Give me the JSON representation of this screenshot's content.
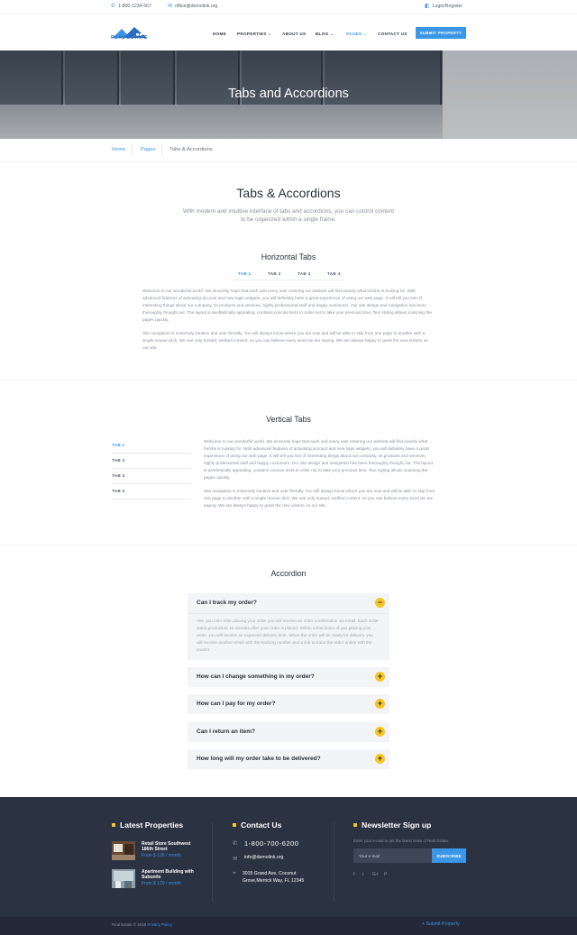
{
  "topbar": {
    "phone": "1-800-1234-567",
    "email": "office@demolink.org",
    "login": "Login/Register"
  },
  "header": {
    "logo_text": "REAL ESTATE",
    "nav": [
      {
        "label": "HOME",
        "has_dropdown": false,
        "active": false
      },
      {
        "label": "PROPERTIES",
        "has_dropdown": true,
        "active": false
      },
      {
        "label": "ABOUT US",
        "has_dropdown": false,
        "active": false
      },
      {
        "label": "BLOG",
        "has_dropdown": true,
        "active": false
      },
      {
        "label": "PAGES",
        "has_dropdown": true,
        "active": true
      },
      {
        "label": "CONTACT US",
        "has_dropdown": false,
        "active": false
      }
    ],
    "submit_label": "SUBMIT PROPERTY"
  },
  "hero": {
    "title": "Tabs and Accordions"
  },
  "breadcrumb": {
    "home": "Home",
    "pages": "Pages",
    "current": "Tabs & Accordions"
  },
  "intro": {
    "title": "Tabs & Accordions",
    "lead": "With modern and intuitive interface of tabs and accordions, you can control content to be organized within a single frame."
  },
  "horizontal": {
    "title": "Horizontal Tabs",
    "tabs": [
      "TAB 1",
      "TAB 2",
      "TAB 3",
      "TAB 4"
    ],
    "p1": "Welcome to our wonderful world. We sincerely hope that each and every user entering our website will find exactly what he/she is looking for. With advanced features of activating account and new login widgets, you will definitely have a great experience of using our web page. It will tell you lots of interesting things about our company, its products and services, highly professional staff and happy customers. Our site design and navigation has been thoroughly thought out. The layout is aesthetically appealing, contains concise texts in order not to take your precious time. Text styling allows scanning the pages quickly.",
    "p2": "Site navigation is extremely intuitive and user-friendly. You will always know where you are now and will be able to skip from one page to another with a single mouse click. We use only trusted, verified content, so you can believe every word we are saying. We are always happy to greet the new visitors on our site."
  },
  "vertical": {
    "title": "Vertical Tabs",
    "tabs": [
      "TAB 1",
      "TAB 2",
      "TAB 3",
      "TAB 4"
    ],
    "p1": "Welcome to our wonderful world. We sincerely hope that each and every user entering our website will find exactly what he/she is looking for. With advanced features of activating account and new login widgets, you will definitely have a great experience of using our web page. It will tell you lots of interesting things about our company, its products and services, highly professional staff and happy customers. Our site design and navigation has been thoroughly thought out. The layout is aesthetically appealing, contains concise texts in order not to take your precious time. Text styling allows scanning the pages quickly.",
    "p2": "Site navigation is extremely intuitive and user-friendly. You will always know where you are now and will be able to skip from one page to another with a single mouse click. We use only trusted, verified content, so you can believe every word we are saying. We are always happy to greet the new visitors on our site."
  },
  "accordion": {
    "title": "Accordion",
    "items": [
      {
        "q": "Can I track my order?",
        "open": true,
        "a": "Yes, you can! After placing your order you will receive an order confirmation via email. Each order starts production 15 minutes after your order is placed. Within a few hours of you placing your order, you will receive an expected delivery time. When the order will be ready for delivery, you will receive another email with the tracking number and a link to trace the order online with the courier."
      },
      {
        "q": "How can I change something in my order?",
        "open": false
      },
      {
        "q": "How can I pay for my order?",
        "open": false
      },
      {
        "q": "Can I return an item?",
        "open": false
      },
      {
        "q": "How long will my order take to be delivered?",
        "open": false
      }
    ]
  },
  "footer": {
    "latest_title": "Latest Properties",
    "properties": [
      {
        "name": "Retail Store Southwest 186th Street",
        "price": "From $ 130 / month"
      },
      {
        "name": "Apartment Building with Subunits",
        "price": "From $ 120 / month"
      }
    ],
    "contact_title": "Contact Us",
    "phone": "1-800-700-6200",
    "email": "info@demolink.org",
    "address": "3015 Grand Ave, Coconut Grove,Merrick Way, FL 12345",
    "newsletter_title": "Newsletter Sign up",
    "newsletter_text": "Enter your e-mail to get the latest news of Real Estate.",
    "email_placeholder": "Your e-mail",
    "subscribe_label": "SUBSCRIBE",
    "social": [
      "f",
      "t",
      "G+",
      "P"
    ],
    "copyright": "Real Estate © 2019",
    "privacy": "Privacy Policy",
    "submit_link": "+ Submit Property"
  },
  "colors": {
    "accent": "#3a96e6",
    "yellow": "#f6c624",
    "footer_bg": "#2b3241"
  }
}
